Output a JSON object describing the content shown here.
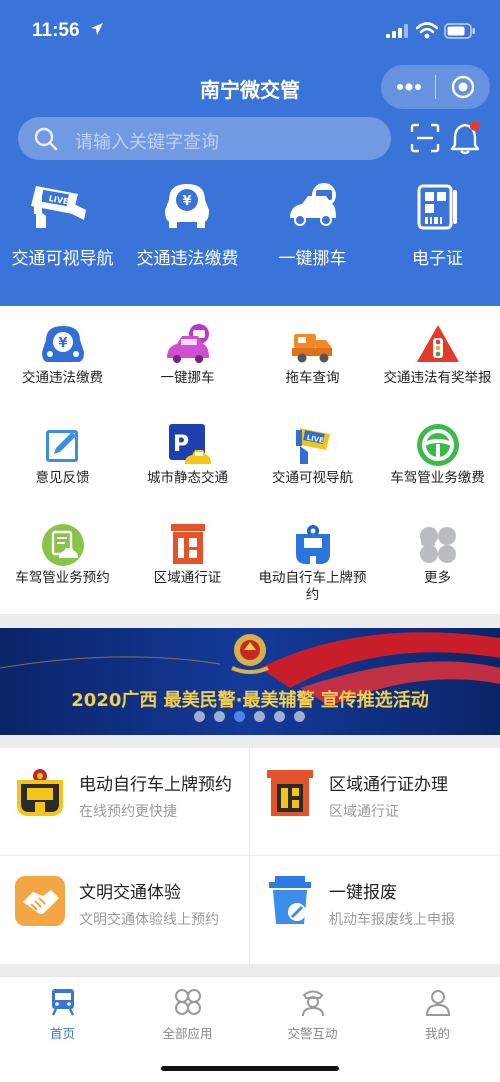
{
  "status_bar": {
    "time": "11:56"
  },
  "header": {
    "title": "南宁微交管",
    "search_placeholder": "请输入关键字查询"
  },
  "top_menu": [
    {
      "label": "交通可视导航",
      "icon": "live-camera-icon"
    },
    {
      "label": "交通违法缴费",
      "icon": "yuan-car-icon"
    },
    {
      "label": "一键挪车",
      "icon": "move-car-icon"
    },
    {
      "label": "电子证",
      "icon": "e-license-icon"
    }
  ],
  "grid": [
    {
      "label": "交通违法缴费",
      "icon": "yuan-car-icon"
    },
    {
      "label": "一键挪车",
      "icon": "move-car-icon"
    },
    {
      "label": "拖车查询",
      "icon": "tow-truck-icon"
    },
    {
      "label": "交通违法有奖举报",
      "icon": "traffic-light-warning-icon"
    },
    {
      "label": "意见反馈",
      "icon": "feedback-edit-icon"
    },
    {
      "label": "城市静态交通",
      "icon": "parking-icon"
    },
    {
      "label": "交通可视导航",
      "icon": "live-camera-icon"
    },
    {
      "label": "车驾管业务缴费",
      "icon": "steering-wheel-icon"
    },
    {
      "label": "车驾管业务预约",
      "icon": "appointment-car-icon"
    },
    {
      "label": "区域通行证",
      "icon": "area-pass-icon"
    },
    {
      "label": "电动自行车上牌预约",
      "icon": "ebike-plate-icon"
    },
    {
      "label": "更多",
      "icon": "more-grid-icon"
    }
  ],
  "banner": {
    "text": "2020广西 最美民警·最美辅警 宣传推选活动",
    "slide_count": 7,
    "active_slide": 2
  },
  "cards": [
    {
      "title": "电动自行车上牌预约",
      "subtitle": "在线预约更快捷",
      "icon": "ebike-plate-icon"
    },
    {
      "title": "区域通行证办理",
      "subtitle": "区域通行证",
      "icon": "area-pass-icon"
    },
    {
      "title": "文明交通体验",
      "subtitle": "文明交通体验线上预约",
      "icon": "handshake-icon"
    },
    {
      "title": "一键报废",
      "subtitle": "机动车报废线上申报",
      "icon": "scrap-car-icon"
    }
  ],
  "tabbar": [
    {
      "label": "首页",
      "icon": "home-train-icon",
      "active": true
    },
    {
      "label": "全部应用",
      "icon": "apps-icon",
      "active": false
    },
    {
      "label": "交警互动",
      "icon": "police-officer-icon",
      "active": false
    },
    {
      "label": "我的",
      "icon": "user-icon",
      "active": false
    }
  ],
  "colors": {
    "brand": "#3b74d8",
    "banner": "#0d2a72",
    "accent_red": "#e23b2e"
  }
}
